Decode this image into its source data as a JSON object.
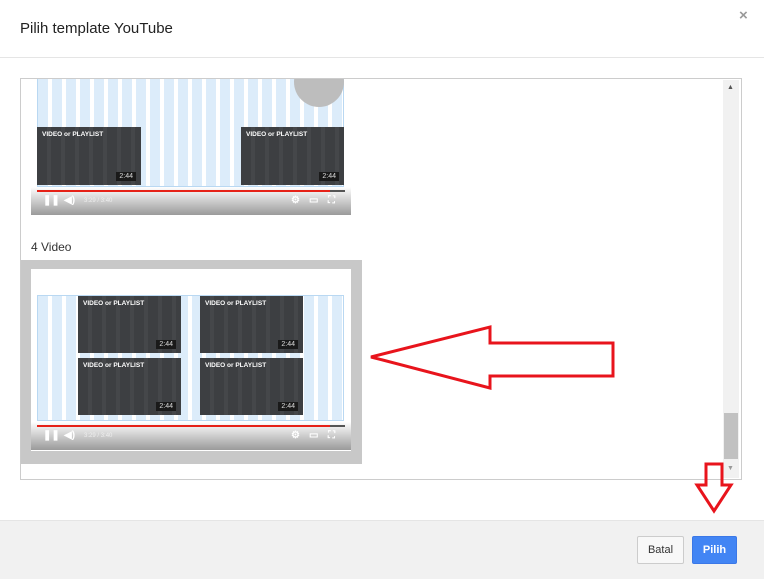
{
  "dialog": {
    "title": "Pilih template YouTube",
    "close_icon": "×"
  },
  "templates": [
    {
      "label": "",
      "video_title": "VIDEO or PLAYLIST",
      "duration": "2:44",
      "time_current": "3:29",
      "time_total": "3:40",
      "progress": 0.95
    },
    {
      "label": "4 Video",
      "video_title": "VIDEO or PLAYLIST",
      "duration": "2:44",
      "time_current": "3:29",
      "time_total": "3:40",
      "progress": 0.95,
      "selected": true
    }
  ],
  "footer": {
    "cancel_label": "Batal",
    "choose_label": "Pilih"
  },
  "colors": {
    "primary": "#4285f4",
    "annotation": "#e8141c"
  }
}
